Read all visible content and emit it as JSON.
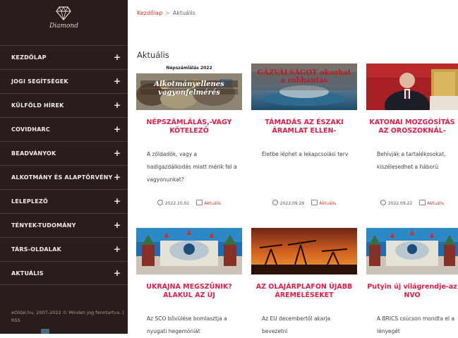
{
  "brand": {
    "name": "Diamond"
  },
  "menu": [
    {
      "label": "KEZDŐLAP"
    },
    {
      "label": "JOGI SEGÍTSÉGEK"
    },
    {
      "label": "KÜLFÖLD HÍREK"
    },
    {
      "label": "COVIDHARC"
    },
    {
      "label": "BEADVÁNYOK"
    },
    {
      "label": "ALKOTMÁNY ÉS ALAPTÖRVÉNY"
    },
    {
      "label": "LELEPLEZŐ"
    },
    {
      "label": "TÉNYEK-TUDOMÁNY"
    },
    {
      "label": "TÁRS-OLDALAK"
    },
    {
      "label": "AKTUÁLIS"
    }
  ],
  "footer": {
    "text": "eOldal.hu, 2007-2022 © Minden jog fenntartva. | RSS"
  },
  "breadcrumb": {
    "home": "Kezdőlap",
    "separator": ">",
    "current": "Aktuális"
  },
  "page": {
    "title": "Aktuális"
  },
  "posts": [
    {
      "title": "NÉPSZÁMLÁLÁS,-VAGY KÖTELEZŐ",
      "excerpt": "A zöldadók, vagy a hadigazdálkodás miatt mérik fel a vagyonunkat?",
      "date": "2022.10.02",
      "category": "Aktuális",
      "image_text": "Népszámlálás 2022",
      "image_caption": "Alkotmányellenes vagyonfelmérés"
    },
    {
      "title": "TÁMADÁS AZ ÉSZAKI ÁRAMLAT ELLEN-",
      "excerpt": "Életbe léphet a lekapcsolási terv",
      "date": "2022.09.29",
      "category": "Aktuális",
      "image_text": "GÁZVÁLSÁGOT okozhat a robbantás"
    },
    {
      "title": "KATONAI MOZGÓSÍTÁS AZ OROSZOKNÁL-",
      "excerpt": "Behívják a tartalékosokat, kiszélesedhet a háború",
      "date": "2022.09.22",
      "category": "Aktuális"
    },
    {
      "title": "UKRAJNA MEGSZŰNIK? ALAKUL AZ ÚJ",
      "excerpt": "Az SCO bővülése bomlasztja a nyugati hegemóniát"
    },
    {
      "title": "AZ OLAJÁRPLAFON ÚJABB ÁREMELÉSEKET",
      "excerpt": "Az EU decembertől akarja bevezetni"
    },
    {
      "title": "Putyin új világrendje-az NVO",
      "excerpt": "A BRICS csúcson mondta el a lényegét"
    }
  ]
}
